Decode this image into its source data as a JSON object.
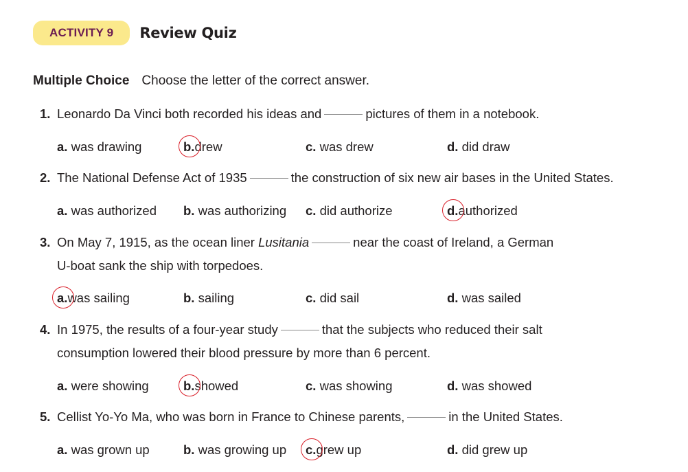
{
  "activity": {
    "badge": "ACTIVITY 9",
    "title": "Review Quiz"
  },
  "section": {
    "label": "Multiple Choice",
    "instruction": "Choose the letter of the correct answer."
  },
  "questions": [
    {
      "number": "1.",
      "before": "Leonardo Da Vinci both recorded his ideas and",
      "after": "pictures of them in a notebook.",
      "options": [
        {
          "letter": "a.",
          "text": "was drawing"
        },
        {
          "letter": "b.",
          "text": "drew"
        },
        {
          "letter": "c.",
          "text": "was drew"
        },
        {
          "letter": "d.",
          "text": "did draw"
        }
      ],
      "circled": "b"
    },
    {
      "number": "2.",
      "before": "The National Defense Act of 1935",
      "after": "the construction of six new air bases in the United States.",
      "options": [
        {
          "letter": "a.",
          "text": "was authorized"
        },
        {
          "letter": "b.",
          "text": "was authorizing"
        },
        {
          "letter": "c.",
          "text": "did authorize"
        },
        {
          "letter": "d.",
          "text": "authorized"
        }
      ],
      "circled": "d"
    },
    {
      "number": "3.",
      "before": "On May 7, 1915, as the ocean liner",
      "italic": "Lusitania",
      "after": "near the coast of Ireland, a German",
      "line2": "U-boat sank the ship with torpedoes.",
      "options": [
        {
          "letter": "a.",
          "text": "was sailing"
        },
        {
          "letter": "b.",
          "text": "sailing"
        },
        {
          "letter": "c.",
          "text": "did sail"
        },
        {
          "letter": "d.",
          "text": "was sailed"
        }
      ],
      "circled": "a"
    },
    {
      "number": "4.",
      "before": "In 1975, the results of a four-year study",
      "after": "that the subjects who reduced their salt",
      "line2": "consumption lowered their blood pressure by more than 6 percent.",
      "options": [
        {
          "letter": "a.",
          "text": "were showing"
        },
        {
          "letter": "b.",
          "text": "showed"
        },
        {
          "letter": "c.",
          "text": "was showing"
        },
        {
          "letter": "d.",
          "text": "was showed"
        }
      ],
      "circled": "b"
    },
    {
      "number": "5.",
      "before": "Cellist Yo-Yo Ma, who was born in France to Chinese parents,",
      "after": "in the United States.",
      "options": [
        {
          "letter": "a.",
          "text": "was grown up"
        },
        {
          "letter": "b.",
          "text": "was growing up"
        },
        {
          "letter": "c.",
          "text": "grew up"
        },
        {
          "letter": "d.",
          "text": "did grew up"
        }
      ],
      "circled": "c"
    }
  ]
}
